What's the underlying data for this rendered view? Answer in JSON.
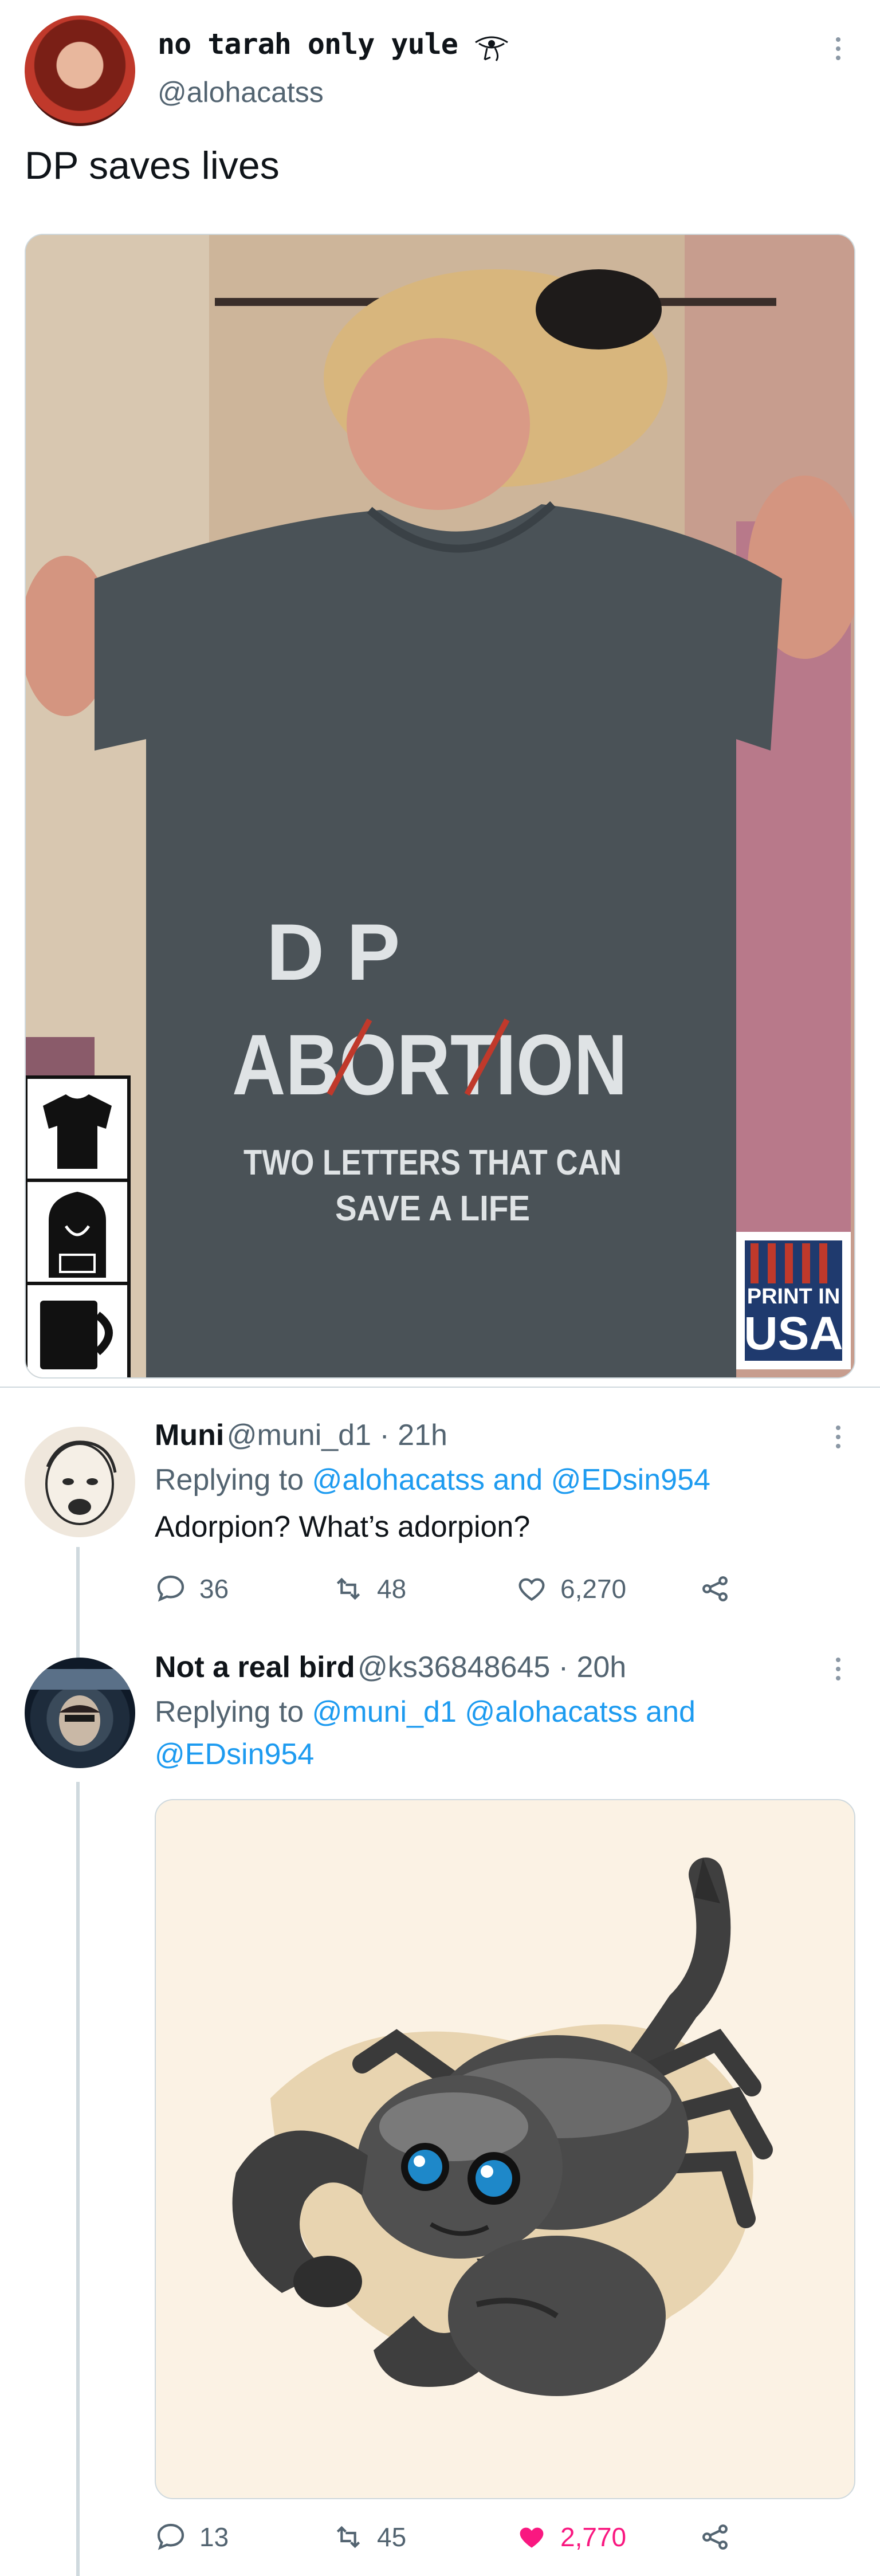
{
  "main_tweet": {
    "author_name": "no tarah only yule",
    "handle": "@alohacatss",
    "text": "DP saves lives",
    "image": {
      "shirt_top": "D   P",
      "shirt_main": "ABORTION",
      "shirt_sub1": "TWO LETTERS THAT CAN",
      "shirt_sub2": "SAVE A LIFE",
      "badge_line1": "PRINT IN",
      "badge_line2": "USA"
    }
  },
  "replies": [
    {
      "author_name": "Muni",
      "handle_time": "@muni_d1 · 21h",
      "replying_prefix": "Replying to ",
      "replying_to": "@alohacatss and @EDsin954",
      "text": "Adorpion?  What’s adorpion?",
      "stats": {
        "replies": "36",
        "retweets": "48",
        "likes": "6,270"
      }
    },
    {
      "author_name": "Not a real bird",
      "handle_time": "@ks36848645 · 20h",
      "replying_prefix": "Replying to ",
      "replying_to_line1": "@muni_d1 @alohacatss and",
      "replying_to_line2": "@EDsin954",
      "stats": {
        "replies": "13",
        "retweets": "45",
        "likes": "2,770"
      }
    }
  ],
  "colors": {
    "link": "#1d9bf0",
    "secondary_text": "#536471",
    "like_active": "#f91880"
  }
}
